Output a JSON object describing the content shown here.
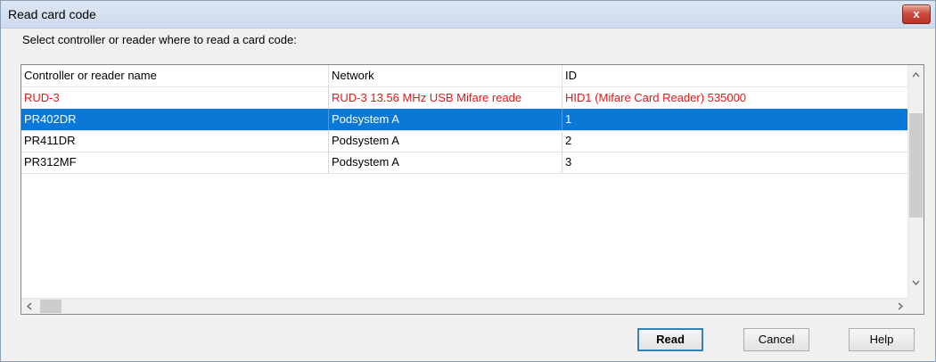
{
  "window": {
    "title": "Read card code",
    "close_label": "x"
  },
  "prompt": "Select controller or reader where to read a card code:",
  "table": {
    "columns": [
      "Controller or reader name",
      "Network",
      "ID"
    ],
    "rows": [
      {
        "name": "RUD-3",
        "network": "RUD-3 13.56 MHz USB Mifare reade",
        "id": "HID1 (Mifare Card Reader) 535000",
        "state": "highlight-red"
      },
      {
        "name": "PR402DR",
        "network": "Podsystem A",
        "id": "1",
        "state": "selected"
      },
      {
        "name": "PR411DR",
        "network": "Podsystem A",
        "id": "2",
        "state": "normal"
      },
      {
        "name": "PR312MF",
        "network": "Podsystem A",
        "id": "3",
        "state": "normal"
      }
    ]
  },
  "scroll": {
    "up_icon": "chevron-up-icon",
    "down_icon": "chevron-down-icon",
    "left_icon": "chevron-left-icon",
    "right_icon": "chevron-right-icon"
  },
  "buttons": {
    "read": "Read",
    "cancel": "Cancel",
    "help": "Help"
  },
  "colors": {
    "selection": "#0a78d7",
    "error_text": "#e81818",
    "close": "#c9483a"
  }
}
